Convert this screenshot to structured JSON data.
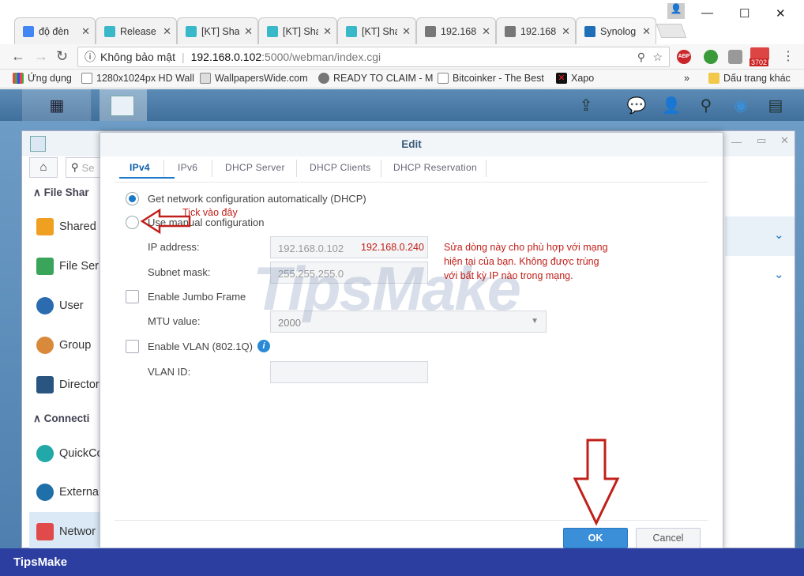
{
  "browser": {
    "tabs": [
      {
        "title": "độ đèn",
        "color": "#4285f4"
      },
      {
        "title": "Release",
        "color": "#38b8c8"
      },
      {
        "title": "[KT] Sha",
        "color": "#38b8c8"
      },
      {
        "title": "[KT] Sha",
        "color": "#38b8c8"
      },
      {
        "title": "[KT] Sha",
        "color": "#38b8c8"
      },
      {
        "title": "192.168",
        "color": "#666"
      },
      {
        "title": "192.168",
        "color": "#666"
      },
      {
        "title": "Synolog",
        "color": "#1e6fb8"
      }
    ],
    "insecure_label": "Không bảo mật",
    "url_host": "192.168.0.102",
    "url_rest": ":5000/webman/index.cgi",
    "badge_count": "3702",
    "bookmarks": [
      "Ứng dụng",
      "1280x1024px HD Wall",
      "WallpapersWide.com",
      "READY TO CLAIM - M",
      "Bitcoinker - The Best",
      "Xapo"
    ],
    "bookmarks_more": "»",
    "other_bookmarks": "Dấu trang khác"
  },
  "sidebar": {
    "search_placeholder": "Se",
    "sections": [
      "File Shar",
      "Connecti"
    ],
    "items": [
      "Shared",
      "File Ser",
      "User",
      "Group",
      "Director",
      "QuickCo",
      "Externa",
      "Networ"
    ]
  },
  "dialog": {
    "title": "Edit",
    "tabs": [
      "IPv4",
      "IPv6",
      "DHCP Server",
      "DHCP Clients",
      "DHCP Reservation"
    ],
    "opt_dhcp": "Get network configuration automatically (DHCP)",
    "opt_manual": "Use manual configuration",
    "ip_label": "IP address:",
    "ip_value": "192.168.0.102",
    "mask_label": "Subnet mask:",
    "mask_value": "255.255.255.0",
    "jumbo_label": "Enable Jumbo Frame",
    "mtu_label": "MTU value:",
    "mtu_value": "2000",
    "vlan_label": "Enable VLAN (802.1Q)",
    "vlanid_label": "VLAN ID:",
    "ok": "OK",
    "cancel": "Cancel"
  },
  "annotations": {
    "tick_here": "Tick vào đây",
    "new_ip": "192.168.0.240",
    "instruction_1": "Sửa dòng này cho phù hợp với mạng",
    "instruction_2": "hiện tại của bạn. Không được trùng",
    "instruction_3": "với bất kỳ IP nào trong mạng."
  },
  "watermark": "TipsMake",
  "footer": "TipsMake",
  "colors": {
    "accent": "#1a78c8",
    "annotation": "#c0201a",
    "footer": "#2c3ea0"
  }
}
